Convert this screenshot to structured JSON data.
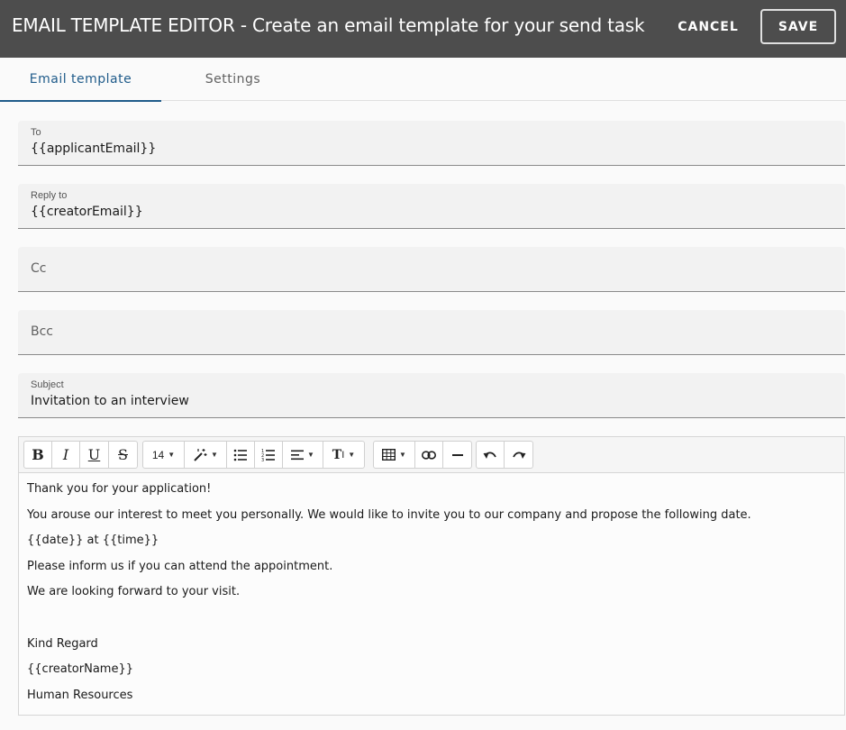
{
  "header": {
    "title": "EMAIL TEMPLATE EDITOR - Create an email template for your send task",
    "cancel_label": "CANCEL",
    "save_label": "SAVE"
  },
  "tabs": [
    {
      "label": "Email template",
      "active": true
    },
    {
      "label": "Settings",
      "active": false
    }
  ],
  "fields": {
    "to": {
      "label": "To",
      "value": "{{applicantEmail}}"
    },
    "reply_to": {
      "label": "Reply to",
      "value": "{{creatorEmail}}"
    },
    "cc": {
      "placeholder": "Cc"
    },
    "bcc": {
      "placeholder": "Bcc"
    },
    "subject": {
      "label": "Subject",
      "value": "Invitation to an interview"
    }
  },
  "toolbar": {
    "font_size": "14",
    "tools": [
      "bold-icon",
      "italic-icon",
      "underline-icon",
      "strikethrough-icon",
      "font-size-select",
      "magic-wand-icon",
      "bullet-list-icon",
      "numbered-list-icon",
      "align-icon",
      "text-height-icon",
      "table-icon",
      "link-icon",
      "horizontal-rule-icon",
      "undo-icon",
      "redo-icon"
    ]
  },
  "body_lines": [
    "Thank you for your application!",
    "You arouse our interest to meet you personally. We would like to invite you to our company and propose the following date.",
    "{{date}} at {{time}}",
    "Please inform us if you can attend the appointment.",
    "We are looking forward to your visit.",
    "",
    "Kind Regard",
    "{{creatorName}}",
    "Human Resources"
  ],
  "colors": {
    "header_bg": "#4d4d4d",
    "accent": "#1f5b8a",
    "field_bg": "#f2f2f2"
  }
}
